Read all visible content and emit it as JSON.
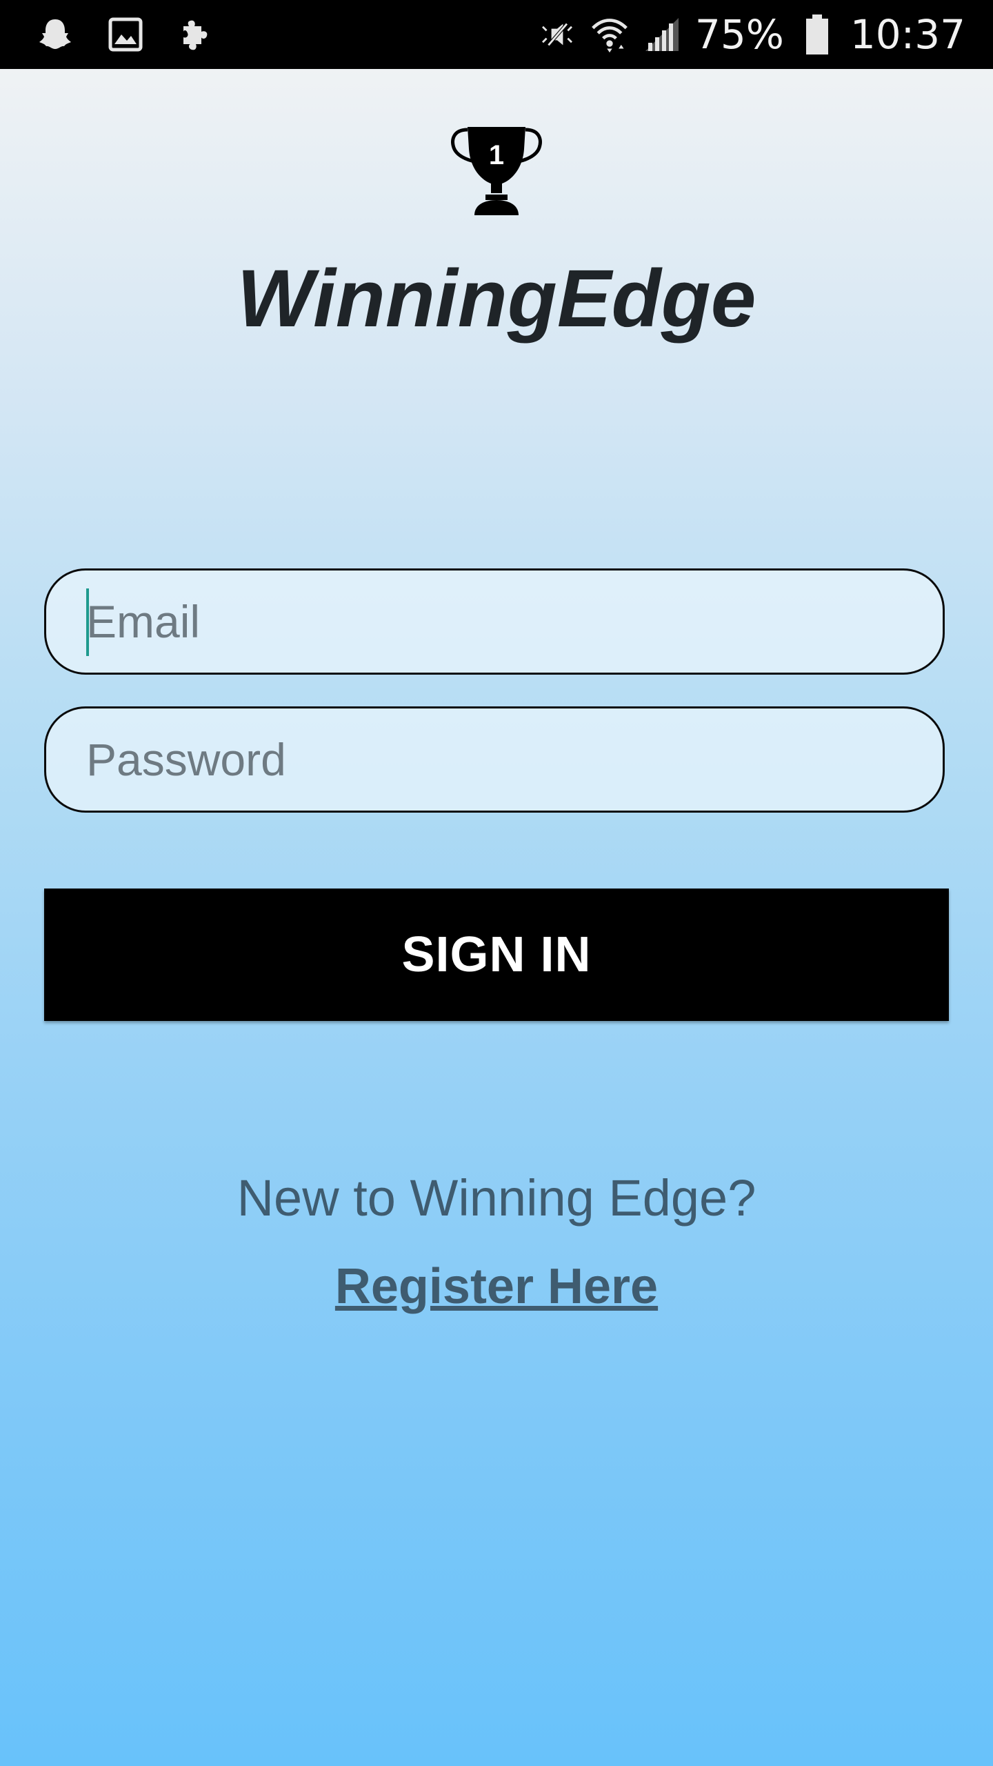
{
  "status_bar": {
    "left_icons": [
      "snapchat-icon",
      "gallery-icon",
      "puzzle-icon"
    ],
    "right_icons": [
      "mute-vibrate-icon",
      "wifi-icon",
      "signal-icon"
    ],
    "battery_percent": "75%",
    "time": "10:37"
  },
  "header": {
    "logo_icon": "trophy-icon",
    "logo_number": "1",
    "app_title": "WinningEdge"
  },
  "form": {
    "email_placeholder": "Email",
    "email_value": "",
    "password_placeholder": "Password",
    "password_value": "",
    "sign_in_label": "SIGN IN"
  },
  "footer": {
    "new_user_text": "New to Winning Edge?",
    "register_label": "Register Here"
  },
  "colors": {
    "background_top": "#eff2f4",
    "background_bottom": "#68c2fa",
    "button": "#000000",
    "link_text": "#3f5c70",
    "caret": "#1e9a8e"
  }
}
